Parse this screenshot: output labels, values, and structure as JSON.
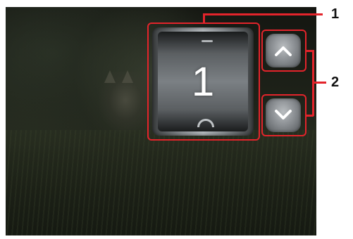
{
  "counter": {
    "value": "1"
  },
  "buttons": {
    "up_icon": "chevron-up-icon",
    "down_icon": "chevron-down-icon"
  },
  "callouts": {
    "label_1": "1",
    "label_2": "2"
  },
  "colors": {
    "highlight": "#e3242b",
    "callout_text": "#111111"
  }
}
